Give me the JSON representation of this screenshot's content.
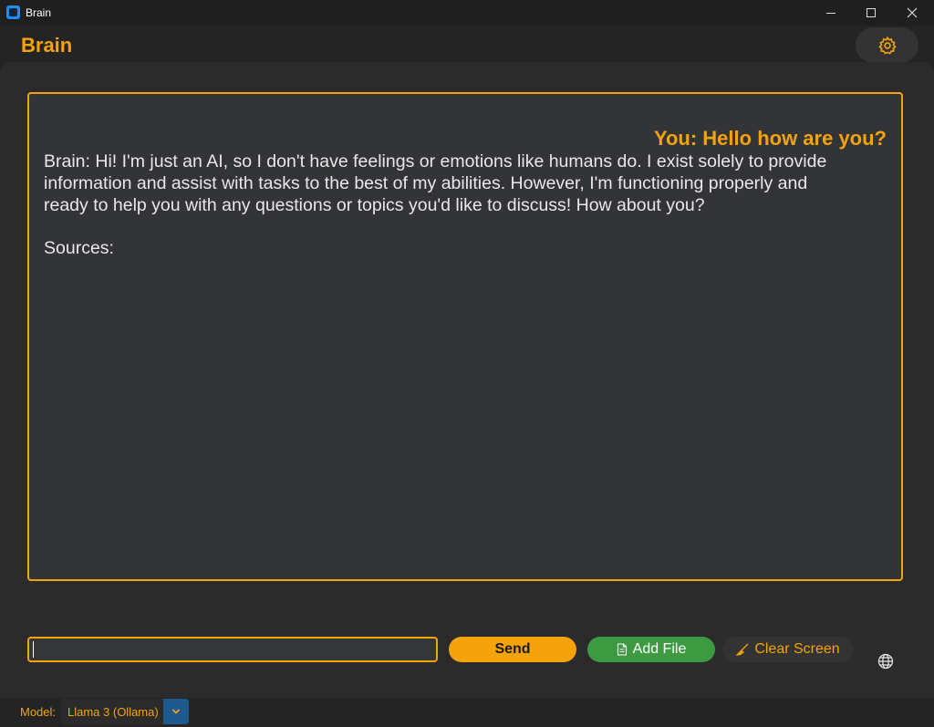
{
  "window": {
    "title": "Brain"
  },
  "header": {
    "app_name": "Brain"
  },
  "chat": {
    "user_message": "You: Hello how are you?",
    "bot_message": "Brain: Hi! I'm just an AI, so I don't have feelings or emotions like humans do. I exist solely to provide information and assist with tasks to the best of my abilities. However, I'm functioning properly and ready to help you with any questions or topics you'd like to discuss! How about you?",
    "sources_label": "Sources:"
  },
  "input": {
    "value": "",
    "placeholder": ""
  },
  "buttons": {
    "send": "Send",
    "add_file": "Add File",
    "clear_screen": "Clear Screen"
  },
  "status": {
    "model_label": "Model:",
    "model_value": "Llama 3 (Ollama)"
  },
  "colors": {
    "accent": "#f5a30a",
    "add_file_green": "#3d9a41",
    "dropdown_blue": "#1f5a8f",
    "chat_background": "#323437"
  },
  "icons": [
    "app-icon",
    "gear-icon",
    "document-icon",
    "broom-icon",
    "globe-icon",
    "chevron-down-icon"
  ]
}
